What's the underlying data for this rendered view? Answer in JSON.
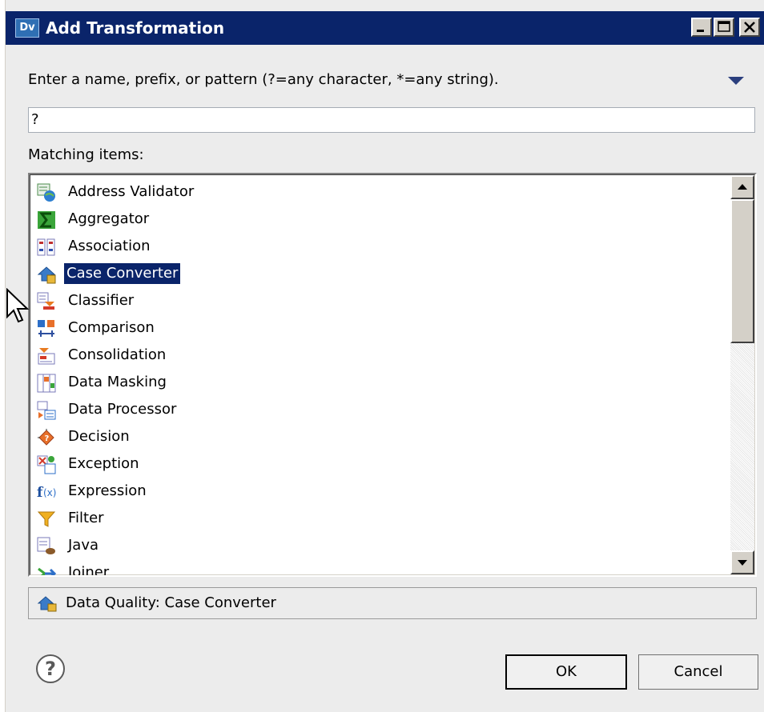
{
  "window": {
    "app_icon_text": "Dv",
    "title": "Add Transformation"
  },
  "instruction": "Enter a name, prefix, or pattern (?=any character, *=any string).",
  "filter": {
    "value": "?"
  },
  "matching_label": "Matching items:",
  "items": [
    {
      "label": "Address Validator",
      "icon": "address-validator-icon"
    },
    {
      "label": "Aggregator",
      "icon": "aggregator-icon"
    },
    {
      "label": "Association",
      "icon": "association-icon"
    },
    {
      "label": "Case Converter",
      "icon": "case-converter-icon",
      "selected": true
    },
    {
      "label": "Classifier",
      "icon": "classifier-icon"
    },
    {
      "label": "Comparison",
      "icon": "comparison-icon"
    },
    {
      "label": "Consolidation",
      "icon": "consolidation-icon"
    },
    {
      "label": "Data Masking",
      "icon": "data-masking-icon"
    },
    {
      "label": "Data Processor",
      "icon": "data-processor-icon"
    },
    {
      "label": "Decision",
      "icon": "decision-icon"
    },
    {
      "label": "Exception",
      "icon": "exception-icon"
    },
    {
      "label": "Expression",
      "icon": "expression-icon"
    },
    {
      "label": "Filter",
      "icon": "filter-icon"
    },
    {
      "label": "Java",
      "icon": "java-icon"
    },
    {
      "label": "Joiner",
      "icon": "joiner-icon"
    }
  ],
  "status": {
    "label": "Data Quality: Case Converter",
    "icon": "case-converter-icon"
  },
  "buttons": {
    "ok": "OK",
    "cancel": "Cancel",
    "help": "?"
  },
  "colors": {
    "titlebar": "#0a246a",
    "selection": "#0a246a",
    "dialog_bg": "#ececec"
  }
}
